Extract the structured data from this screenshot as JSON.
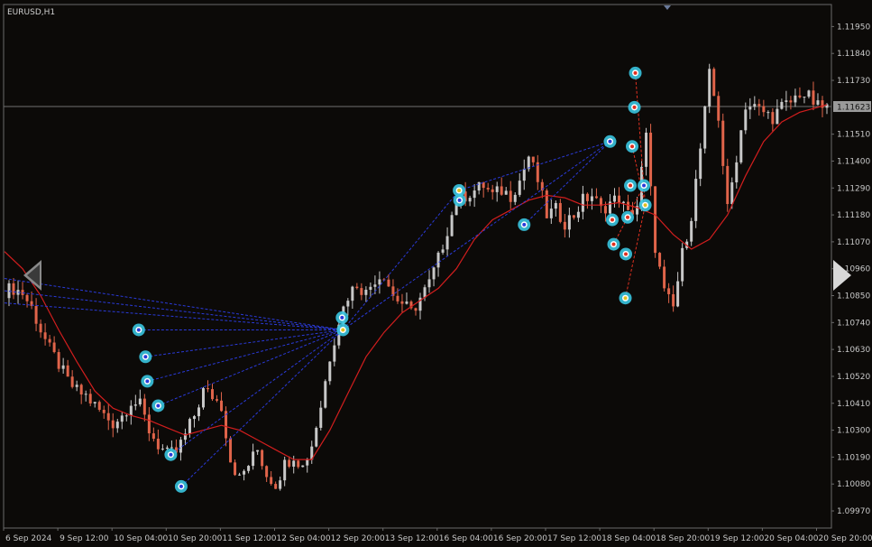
{
  "symbol": "EURUSD,H1",
  "colors": {
    "background": "#0c0a08",
    "frame": "#6a6a6a",
    "bull": "#c8c8c8",
    "bear": "#e0644a",
    "ma": "#d21e1e",
    "dashed_blue": "#2a3ad8",
    "dashed_red": "#e03020",
    "marker": "#38c4e0",
    "price_label_bg": "#9a9a9a",
    "price_line": "#707070"
  },
  "chart_data": {
    "type": "candlestick",
    "title": "EURUSD,H1",
    "ylim": [
      1.099,
      1.1204
    ],
    "y_ticks": [
      "1.11950",
      "1.11840",
      "1.11730",
      "1.11623",
      "1.11510",
      "1.11400",
      "1.11290",
      "1.11180",
      "1.11070",
      "1.10960",
      "1.10850",
      "1.10740",
      "1.10630",
      "1.10520",
      "1.10410",
      "1.10300",
      "1.10190",
      "1.10080",
      "1.09970"
    ],
    "current_price": "1.11623",
    "x_ticks": [
      "6 Sep 2024",
      "9 Sep 12:00",
      "10 Sep 04:00",
      "10 Sep 20:00",
      "11 Sep 12:00",
      "12 Sep 04:00",
      "12 Sep 20:00",
      "13 Sep 12:00",
      "16 Sep 04:00",
      "16 Sep 20:00",
      "17 Sep 12:00",
      "18 Sep 04:00",
      "18 Sep 20:00",
      "19 Sep 12:00",
      "20 Sep 04:00",
      "20 Sep 20:00"
    ],
    "close_path": [
      [
        0,
        1.1087
      ],
      [
        2,
        1.1088
      ],
      [
        4,
        1.1086
      ],
      [
        6,
        1.108
      ],
      [
        8,
        1.1071
      ],
      [
        10,
        1.1063
      ],
      [
        12,
        1.1057
      ],
      [
        14,
        1.105
      ],
      [
        16,
        1.1046
      ],
      [
        18,
        1.1044
      ],
      [
        20,
        1.104
      ],
      [
        22,
        1.1036
      ],
      [
        24,
        1.1033
      ],
      [
        26,
        1.1036
      ],
      [
        28,
        1.1042
      ],
      [
        30,
        1.104
      ],
      [
        32,
        1.103
      ],
      [
        34,
        1.1024
      ],
      [
        36,
        1.102
      ],
      [
        38,
        1.1021
      ],
      [
        40,
        1.1028
      ],
      [
        42,
        1.1036
      ],
      [
        44,
        1.1046
      ],
      [
        46,
        1.1044
      ],
      [
        48,
        1.104
      ],
      [
        50,
        1.1018
      ],
      [
        52,
        1.101
      ],
      [
        54,
        1.1016
      ],
      [
        56,
        1.1022
      ],
      [
        58,
        1.1012
      ],
      [
        60,
        1.1008
      ],
      [
        62,
        1.1016
      ],
      [
        64,
        1.102
      ],
      [
        66,
        1.1015
      ],
      [
        68,
        1.1024
      ],
      [
        70,
        1.104
      ],
      [
        72,
        1.106
      ],
      [
        74,
        1.1075
      ],
      [
        76,
        1.1085
      ],
      [
        78,
        1.109
      ],
      [
        80,
        1.1086
      ],
      [
        82,
        1.1092
      ],
      [
        84,
        1.1094
      ],
      [
        86,
        1.1085
      ],
      [
        88,
        1.1082
      ],
      [
        90,
        1.1078
      ],
      [
        92,
        1.1084
      ],
      [
        94,
        1.109
      ],
      [
        96,
        1.11
      ],
      [
        98,
        1.1112
      ],
      [
        100,
        1.1124
      ],
      [
        102,
        1.1126
      ],
      [
        104,
        1.1128
      ],
      [
        106,
        1.113
      ],
      [
        108,
        1.1126
      ],
      [
        110,
        1.1128
      ],
      [
        112,
        1.1126
      ],
      [
        114,
        1.1132
      ],
      [
        116,
        1.1142
      ],
      [
        118,
        1.1132
      ],
      [
        120,
        1.1118
      ],
      [
        122,
        1.112
      ],
      [
        124,
        1.1115
      ],
      [
        126,
        1.1118
      ],
      [
        128,
        1.1124
      ],
      [
        130,
        1.1126
      ],
      [
        132,
        1.112
      ],
      [
        134,
        1.1123
      ],
      [
        136,
        1.1125
      ],
      [
        138,
        1.1118
      ],
      [
        140,
        1.1122
      ],
      [
        142,
        1.115
      ],
      [
        144,
        1.1105
      ],
      [
        146,
        1.1086
      ],
      [
        148,
        1.108
      ],
      [
        150,
        1.1102
      ],
      [
        152,
        1.1118
      ],
      [
        154,
        1.1145
      ],
      [
        156,
        1.1175
      ],
      [
        158,
        1.1158
      ],
      [
        160,
        1.112
      ],
      [
        162,
        1.1142
      ],
      [
        164,
        1.1163
      ],
      [
        166,
        1.1162
      ],
      [
        168,
        1.116
      ],
      [
        170,
        1.1158
      ],
      [
        172,
        1.1162
      ],
      [
        174,
        1.1164
      ],
      [
        176,
        1.1168
      ],
      [
        178,
        1.1166
      ],
      [
        180,
        1.1162
      ],
      [
        182,
        1.1162
      ]
    ],
    "ma_path": [
      [
        0,
        1.1103
      ],
      [
        4,
        1.1096
      ],
      [
        8,
        1.1085
      ],
      [
        12,
        1.1071
      ],
      [
        16,
        1.1058
      ],
      [
        20,
        1.1046
      ],
      [
        24,
        1.1039
      ],
      [
        28,
        1.1036
      ],
      [
        32,
        1.1034
      ],
      [
        36,
        1.1031
      ],
      [
        40,
        1.1028
      ],
      [
        44,
        1.103
      ],
      [
        48,
        1.1032
      ],
      [
        52,
        1.103
      ],
      [
        56,
        1.1026
      ],
      [
        60,
        1.1022
      ],
      [
        64,
        1.1018
      ],
      [
        68,
        1.1018
      ],
      [
        72,
        1.103
      ],
      [
        76,
        1.1045
      ],
      [
        80,
        1.106
      ],
      [
        84,
        1.107
      ],
      [
        88,
        1.1078
      ],
      [
        92,
        1.1083
      ],
      [
        96,
        1.1088
      ],
      [
        100,
        1.1096
      ],
      [
        104,
        1.1108
      ],
      [
        108,
        1.1116
      ],
      [
        112,
        1.112
      ],
      [
        116,
        1.1124
      ],
      [
        120,
        1.1126
      ],
      [
        124,
        1.1125
      ],
      [
        128,
        1.1122
      ],
      [
        132,
        1.1122
      ],
      [
        136,
        1.1123
      ],
      [
        140,
        1.1121
      ],
      [
        144,
        1.1118
      ],
      [
        148,
        1.111
      ],
      [
        152,
        1.1104
      ],
      [
        156,
        1.1108
      ],
      [
        160,
        1.1118
      ],
      [
        164,
        1.1134
      ],
      [
        168,
        1.1148
      ],
      [
        172,
        1.1156
      ],
      [
        176,
        1.116
      ],
      [
        180,
        1.1162
      ],
      [
        182,
        1.1163
      ]
    ],
    "markers": [
      {
        "x": 29.7,
        "y": 1.1071,
        "c": "#2a3ad8"
      },
      {
        "x": 31.2,
        "y": 1.106,
        "c": "#2a3ad8"
      },
      {
        "x": 31.6,
        "y": 1.105,
        "c": "#2a3ad8"
      },
      {
        "x": 34.0,
        "y": 1.104,
        "c": "#2a3ad8"
      },
      {
        "x": 36.8,
        "y": 1.102,
        "c": "#2a3ad8"
      },
      {
        "x": 39.1,
        "y": 1.1007,
        "c": "#2a3ad8"
      },
      {
        "x": 74.7,
        "y": 1.1076,
        "c": "#2a3ad8"
      },
      {
        "x": 74.9,
        "y": 1.1071,
        "c": "#e0c020"
      },
      {
        "x": 100.6,
        "y": 1.1128,
        "c": "#e0c020"
      },
      {
        "x": 100.7,
        "y": 1.1124,
        "c": "#2a3ad8"
      },
      {
        "x": 115.0,
        "y": 1.1114,
        "c": "#2a3ad8"
      },
      {
        "x": 134.0,
        "y": 1.1148,
        "c": "#2a3ad8"
      },
      {
        "x": 134.5,
        "y": 1.1116,
        "c": "#e03020"
      },
      {
        "x": 134.8,
        "y": 1.1106,
        "c": "#e03020"
      },
      {
        "x": 137.4,
        "y": 1.1084,
        "c": "#e0c020"
      },
      {
        "x": 137.5,
        "y": 1.1102,
        "c": "#e03020"
      },
      {
        "x": 137.9,
        "y": 1.1117,
        "c": "#e03020"
      },
      {
        "x": 138.5,
        "y": 1.113,
        "c": "#e03020"
      },
      {
        "x": 138.9,
        "y": 1.1146,
        "c": "#e03020"
      },
      {
        "x": 139.4,
        "y": 1.1162,
        "c": "#e03020"
      },
      {
        "x": 139.6,
        "y": 1.1176,
        "c": "#e03020"
      },
      {
        "x": 141.5,
        "y": 1.113,
        "c": "#2a3ad8"
      },
      {
        "x": 141.8,
        "y": 1.1122,
        "c": "#e0c020"
      }
    ]
  }
}
